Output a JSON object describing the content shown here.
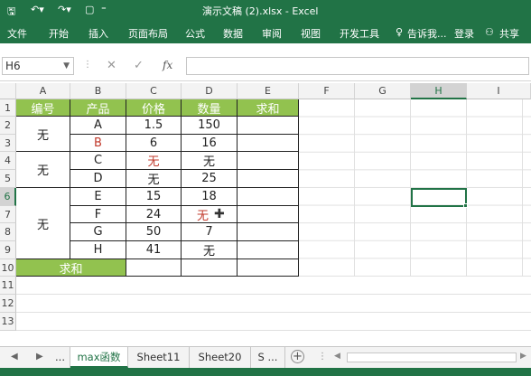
{
  "window": {
    "title": "演示文稿 (2).xlsx - Excel"
  },
  "ribbon": {
    "tabs": [
      "文件",
      "开始",
      "插入",
      "页面布局",
      "公式",
      "数据",
      "审阅",
      "视图",
      "开发工具"
    ],
    "tell_me": "告诉我...",
    "login": "登录",
    "share": "共享"
  },
  "formula": {
    "name_box": "H6",
    "fx": "fx",
    "value": ""
  },
  "columns": [
    "A",
    "B",
    "C",
    "D",
    "E",
    "F",
    "G",
    "H",
    "I"
  ],
  "rows": [
    "1",
    "2",
    "3",
    "4",
    "5",
    "6",
    "7",
    "8",
    "9",
    "10",
    "11",
    "12",
    "13"
  ],
  "table": {
    "headers": [
      "编号",
      "产品",
      "价格",
      "数量",
      "求和"
    ],
    "ids": [
      "无",
      "无",
      "无"
    ],
    "products": [
      "A",
      "B",
      "C",
      "D",
      "E",
      "F",
      "G",
      "H"
    ],
    "prices": [
      "1.5",
      "6",
      "无",
      "无",
      "15",
      "24",
      "50",
      "41"
    ],
    "quantities": [
      "150",
      "16",
      "无",
      "25",
      "18",
      "无",
      "7",
      "无"
    ],
    "sum_label": "求和"
  },
  "selected_cell": "H6",
  "sheets": [
    "...",
    "max函数",
    "Sheet11",
    "Sheet20",
    "S ..."
  ],
  "active_sheet": "max函数",
  "colors": {
    "accent": "#217346",
    "header_fill": "#92c24f",
    "red_text": "#c0392b"
  }
}
